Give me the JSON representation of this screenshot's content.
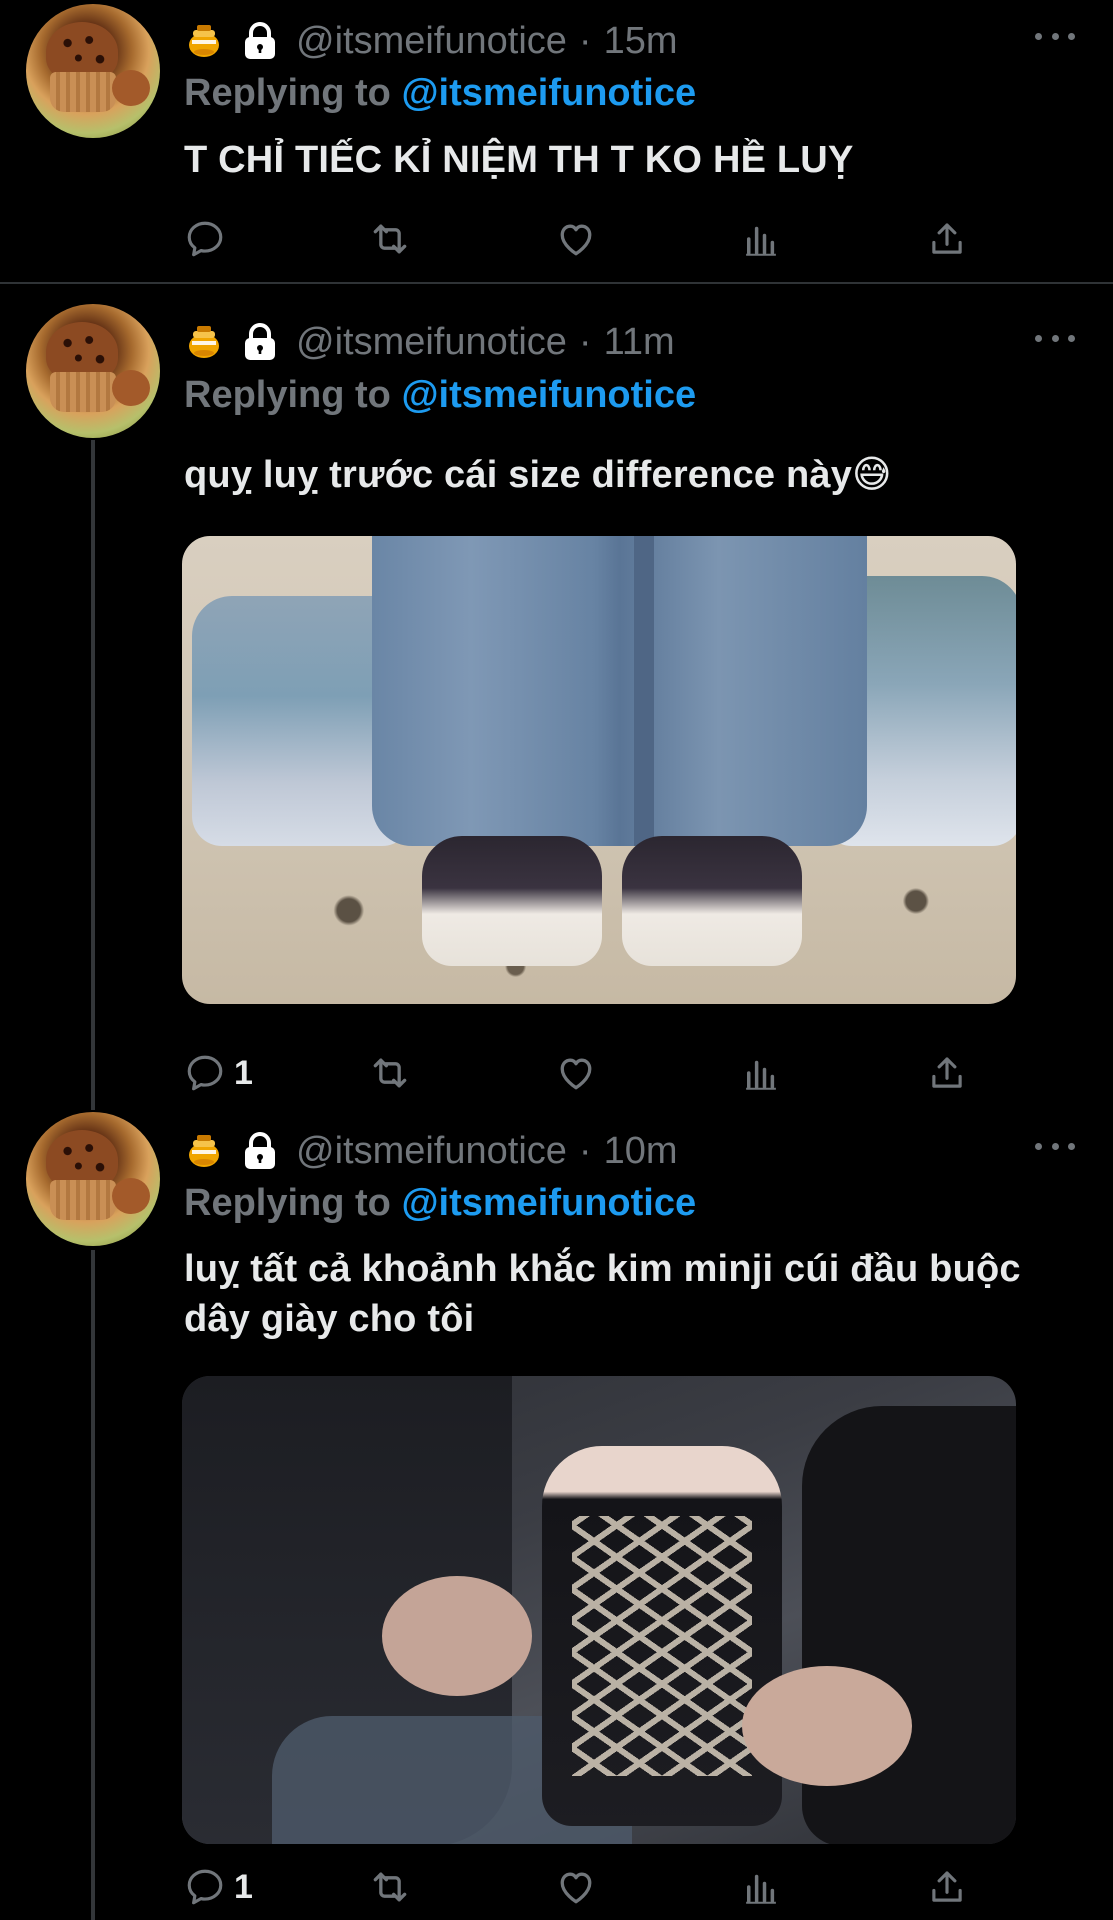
{
  "colors": {
    "background": "#000000",
    "text": "#e7e9ea",
    "muted": "#71767b",
    "mention": "#1d9bf0",
    "divider": "#2f3336"
  },
  "tweets": [
    {
      "handle": "@itsmeifunotice",
      "separator": "·",
      "time": "15m",
      "replying_label": "Replying to",
      "replying_to": "@itsmeifunotice",
      "text": "T CHỈ TIẾC KỈ NIỆM TH T KO HỀ LUỴ",
      "reply_count": "",
      "icons": [
        "honey-pot-emoji",
        "lock-icon",
        "more-icon",
        "reply-icon",
        "retweet-icon",
        "like-icon",
        "analytics-icon",
        "share-icon"
      ]
    },
    {
      "handle": "@itsmeifunotice",
      "separator": "·",
      "time": "11m",
      "replying_label": "Replying to",
      "replying_to": "@itsmeifunotice",
      "text": "quỵ luỵ trước cái size difference này😅",
      "reply_count": "1",
      "icons": [
        "honey-pot-emoji",
        "lock-icon",
        "more-icon",
        "reply-icon",
        "retweet-icon",
        "like-icon",
        "analytics-icon",
        "share-icon"
      ]
    },
    {
      "handle": "@itsmeifunotice",
      "separator": "·",
      "time": "10m",
      "replying_label": "Replying to",
      "replying_to": "@itsmeifunotice",
      "text": "luỵ tất cả khoảnh khắc kim minji cúi đầu buộc dây giày cho tôi",
      "reply_count": "1",
      "icons": [
        "honey-pot-emoji",
        "lock-icon",
        "more-icon",
        "reply-icon",
        "retweet-icon",
        "like-icon",
        "analytics-icon",
        "share-icon"
      ]
    }
  ]
}
